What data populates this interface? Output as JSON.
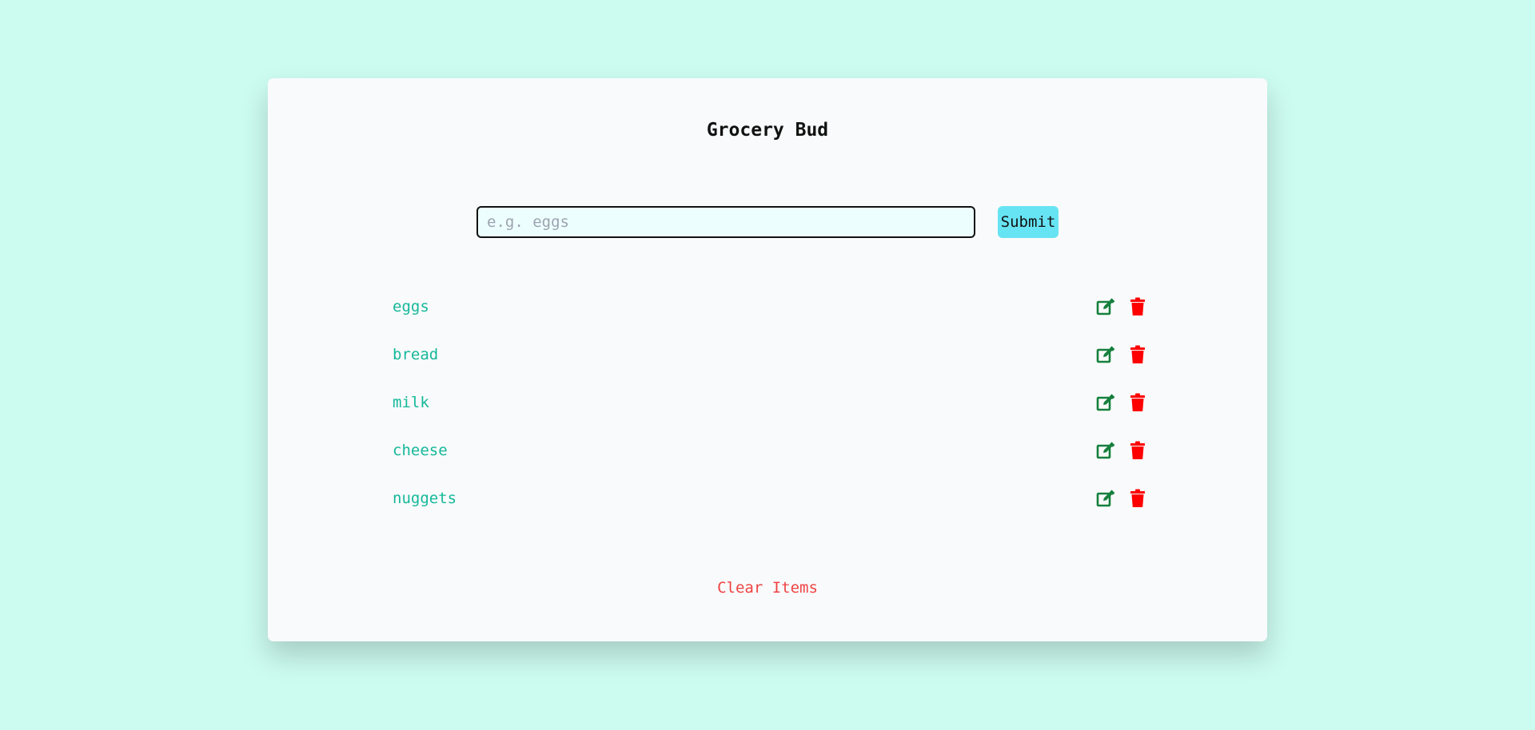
{
  "app": {
    "title": "Grocery Bud"
  },
  "form": {
    "placeholder": "e.g. eggs",
    "value": "",
    "submit_label": "Submit"
  },
  "items": [
    {
      "name": "eggs"
    },
    {
      "name": "bread"
    },
    {
      "name": "milk"
    },
    {
      "name": "cheese"
    },
    {
      "name": "nuggets"
    }
  ],
  "icons": {
    "edit": "edit-icon",
    "delete": "trash-icon"
  },
  "clear_label": "Clear Items",
  "colors": {
    "background": "#ccfbef",
    "card": "#f9fafb",
    "item_text": "#14b89a",
    "edit_icon": "#15803d",
    "delete_icon": "#ff0000",
    "submit_bg": "#67e4f3",
    "clear_text": "#ef4444",
    "input_bg": "#ecfefd"
  }
}
